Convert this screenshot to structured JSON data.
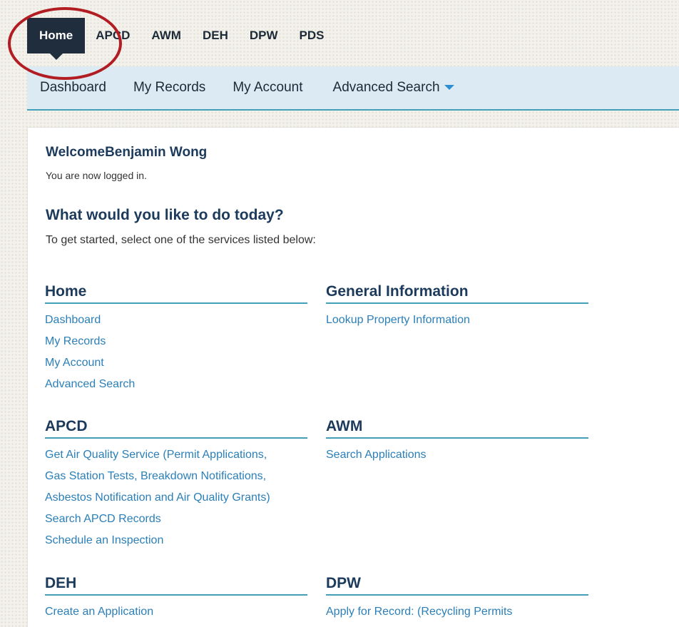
{
  "top_nav": {
    "tabs": [
      {
        "label": "Home",
        "active": true
      },
      {
        "label": "APCD"
      },
      {
        "label": "AWM"
      },
      {
        "label": "DEH"
      },
      {
        "label": "DPW"
      },
      {
        "label": "PDS"
      }
    ]
  },
  "sub_nav": {
    "items": [
      "Dashboard",
      "My Records",
      "My Account",
      "Advanced Search"
    ]
  },
  "welcome": {
    "heading": "WelcomeBenjamin Wong",
    "status": "You are now logged in."
  },
  "prompt": {
    "question": "What would you like to do today?",
    "instruction": "To get started, select one of the services listed below:"
  },
  "sections": {
    "home": {
      "title": "Home",
      "links": [
        "Dashboard",
        "My Records",
        "My Account",
        "Advanced Search"
      ]
    },
    "general": {
      "title": "General Information",
      "links": [
        "Lookup Property Information"
      ]
    },
    "apcd": {
      "title": "APCD",
      "links": [
        "Get Air Quality Service (Permit Applications,",
        "Gas Station Tests, Breakdown Notifications,",
        "Asbestos Notification and Air Quality Grants)",
        "Search APCD Records",
        "Schedule an Inspection"
      ]
    },
    "awm": {
      "title": "AWM",
      "links": [
        "Search Applications"
      ]
    },
    "deh": {
      "title": "DEH",
      "links": [
        "Create an Application"
      ]
    },
    "dpw": {
      "title": "DPW",
      "links": [
        "Apply for Record: (Recycling Permits"
      ]
    }
  },
  "colors": {
    "accent": "#3fa0b7",
    "link": "#2b7fb8",
    "nav_active": "#1f2d3d",
    "highlight_circle": "#b11d22"
  }
}
